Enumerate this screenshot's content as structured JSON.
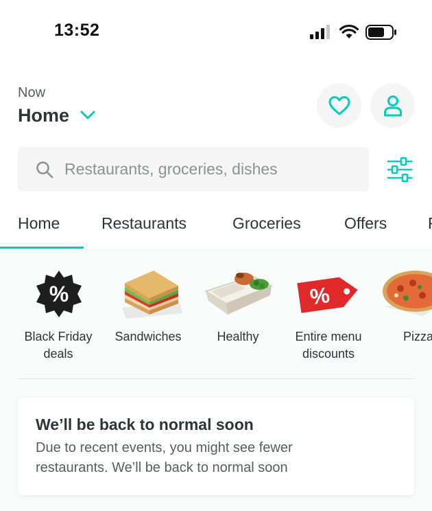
{
  "status_bar": {
    "time": "13:52"
  },
  "header": {
    "delivery_time": "Now",
    "location": "Home"
  },
  "search": {
    "placeholder": "Restaurants, groceries, dishes"
  },
  "tabs": [
    {
      "label": "Home",
      "active": true
    },
    {
      "label": "Restaurants",
      "active": false
    },
    {
      "label": "Groceries",
      "active": false
    },
    {
      "label": "Offers",
      "active": false
    },
    {
      "label": "F",
      "active": false
    }
  ],
  "categories": [
    {
      "label": "Black Friday\ndeals",
      "line1": "Black Friday",
      "line2": "deals",
      "icon": "percent-badge-icon"
    },
    {
      "label": "Sandwiches",
      "line1": "Sandwiches",
      "line2": "",
      "icon": "sandwich-image"
    },
    {
      "label": "Healthy",
      "line1": "Healthy",
      "line2": "",
      "icon": "healthy-bowl-image"
    },
    {
      "label": "Entire menu\ndiscounts",
      "line1": "Entire menu",
      "line2": "discounts",
      "icon": "percent-tag-icon"
    },
    {
      "label": "Pizza",
      "line1": "Pizza",
      "line2": "",
      "icon": "pizza-image"
    }
  ],
  "notice": {
    "title": "We’ll be back to normal soon",
    "body": "Due to recent events, you might see fewer restaurants. We’ll be back to normal soon"
  },
  "colors": {
    "accent": "#00ccbc",
    "text": "#2e3333",
    "muted": "#585c5c",
    "promo_red": "#e0292b"
  }
}
